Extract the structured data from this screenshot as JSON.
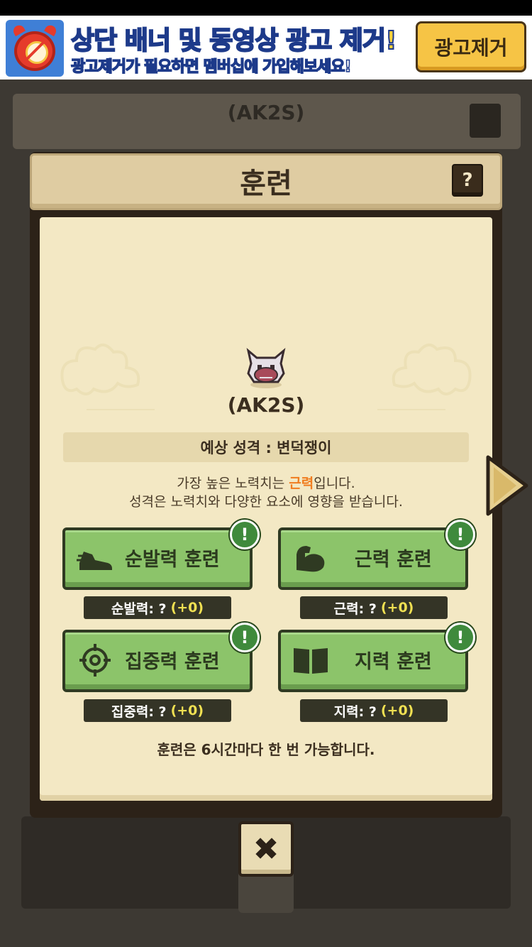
{
  "ad": {
    "title": "상단 배너 및 동영상 광고 제거!",
    "subtitle": "광고제거가 필요하면 멤버십에 가입해보세요!",
    "button_label": "광고제거"
  },
  "background": {
    "title": "(AK2S)"
  },
  "modal": {
    "title": "훈련",
    "help_label": "?",
    "character_name": "(AK2S)",
    "personality": "예상 성격 : 변덕쟁이",
    "desc_line1_prefix": "가장 높은 노력치는 ",
    "desc_line1_highlight": "근력",
    "desc_line1_suffix": "입니다.",
    "desc_line2": "성격은 노력치와 다양한 요소에 영향을 받습니다.",
    "trainings": [
      {
        "label": "순발력 훈련",
        "icon": "shoe-icon",
        "badge": "!",
        "stat_label": "순발력: ?",
        "stat_value": "(+0)"
      },
      {
        "label": "근력 훈련",
        "icon": "muscle-arm-icon",
        "badge": "!",
        "stat_label": "근력: ?",
        "stat_value": "(+0)"
      },
      {
        "label": "집중력 훈련",
        "icon": "crosshair-icon",
        "badge": "!",
        "stat_label": "집중력: ?",
        "stat_value": "(+0)"
      },
      {
        "label": "지력 훈련",
        "icon": "book-icon",
        "badge": "!",
        "stat_label": "지력: ?",
        "stat_value": "(+0)"
      }
    ],
    "footnote": "훈련은 6시간마다 한 번 가능합니다.",
    "close_label": "✖"
  },
  "colors": {
    "highlight": "#f07c1e",
    "button_green": "#8cc46a",
    "badge_green": "#3f8a3c",
    "stat_value": "#f0e052",
    "parchment": "#f3e8c4"
  }
}
